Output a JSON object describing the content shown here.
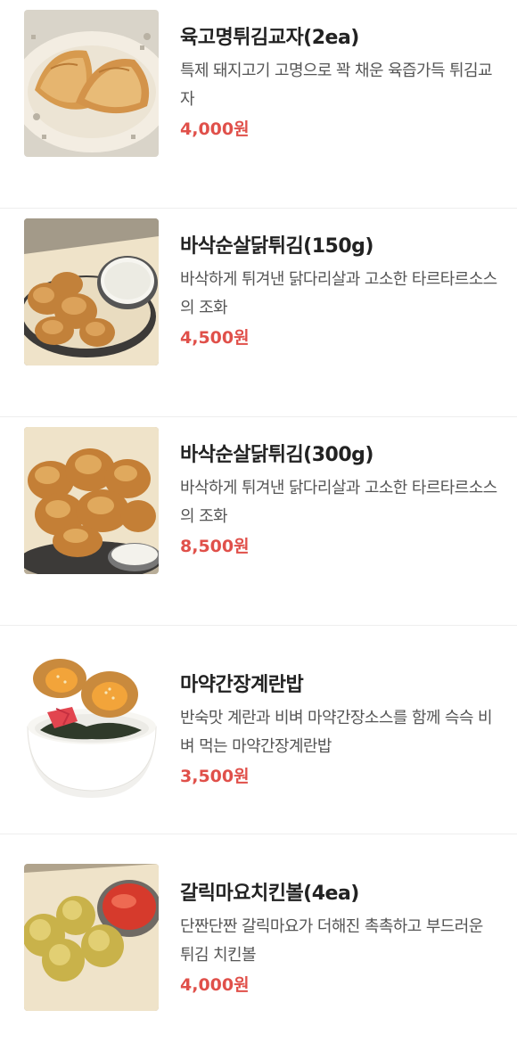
{
  "menu": {
    "items": [
      {
        "name": "육고명튀김교자(2ea)",
        "description": "특제 돼지고기 고명으로 꽉 채운 육즙가득 튀김교자",
        "price": "4,000원",
        "image_icon": "fried-dumpling-image"
      },
      {
        "name": "바삭순살닭튀김(150g)",
        "description": "바삭하게 튀겨낸 닭다리살과 고소한 타르타르소스의 조화",
        "price": "4,500원",
        "image_icon": "fried-chicken-small-image"
      },
      {
        "name": "바삭순살닭튀김(300g)",
        "description": "바삭하게 튀겨낸 닭다리살과 고소한 타르타르소스의 조화",
        "price": "8,500원",
        "image_icon": "fried-chicken-large-image"
      },
      {
        "name": "마약간장계란밥",
        "description": "반숙맛 계란과 비벼 마약간장소스를 함께 슥슥 비벼 먹는 마약간장계란밥",
        "price": "3,500원",
        "image_icon": "soy-egg-rice-image"
      },
      {
        "name": "갈릭마요치킨볼(4ea)",
        "description": "단짠단짠 갈릭마요가 더해진 촉촉하고 부드러운 튀김 치킨볼",
        "price": "4,000원",
        "image_icon": "garlic-mayo-chicken-ball-image"
      }
    ]
  },
  "colors": {
    "price": "#e0504a",
    "divider": "#eeeeee"
  }
}
